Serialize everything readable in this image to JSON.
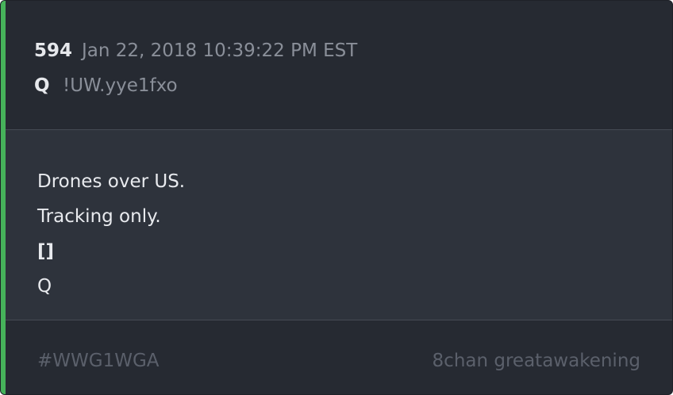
{
  "post": {
    "number": "594",
    "date": "Jan 22, 2018 10:39:22 PM EST",
    "author": "Q",
    "tripcode": "!UW.yye1fxo"
  },
  "message": {
    "lines": [
      "Drones over US.",
      "Tracking only.",
      "[]",
      "Q"
    ]
  },
  "footer": {
    "hashtag": "#WWG1WGA",
    "source": "8chan greatawakening"
  },
  "colors": {
    "accent": "#46b25a",
    "background": "#272b33",
    "body_background": "#2e333c"
  }
}
